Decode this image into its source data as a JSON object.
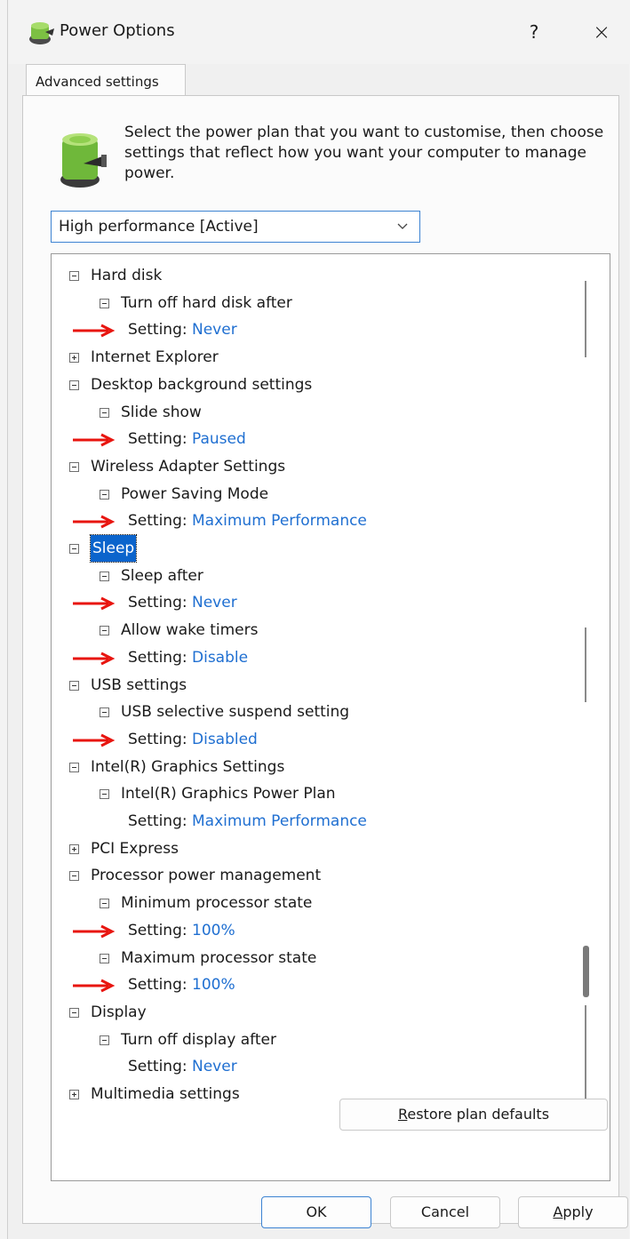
{
  "window": {
    "title": "Power Options",
    "help_label": "?",
    "close_label": "×"
  },
  "tab": {
    "label": "Advanced settings"
  },
  "intro_text": "Select the power plan that you want to customise, then choose settings that reflect how you want your computer to manage power.",
  "plan_select": {
    "value": "High performance [Active]"
  },
  "setting_prefix": "Setting:",
  "tree": [
    {
      "label": "Hard disk",
      "level": 0,
      "toggle": "minus"
    },
    {
      "label": "Turn off hard disk after",
      "level": 1,
      "toggle": "minus"
    },
    {
      "label": "Setting:",
      "value": "Never",
      "level": 2,
      "arrow": true
    },
    {
      "label": "Internet Explorer",
      "level": 0,
      "toggle": "plus"
    },
    {
      "label": "Desktop background settings",
      "level": 0,
      "toggle": "minus"
    },
    {
      "label": "Slide show",
      "level": 1,
      "toggle": "minus"
    },
    {
      "label": "Setting:",
      "value": "Paused",
      "level": 2,
      "arrow": true
    },
    {
      "label": "Wireless Adapter Settings",
      "level": 0,
      "toggle": "minus"
    },
    {
      "label": "Power Saving Mode",
      "level": 1,
      "toggle": "minus"
    },
    {
      "label": "Setting:",
      "value": "Maximum Performance",
      "level": 2,
      "arrow": true
    },
    {
      "label": "Sleep",
      "level": 0,
      "toggle": "minus",
      "selected": true
    },
    {
      "label": "Sleep after",
      "level": 1,
      "toggle": "minus"
    },
    {
      "label": "Setting:",
      "value": "Never",
      "level": 2,
      "arrow": true
    },
    {
      "label": "Allow wake timers",
      "level": 1,
      "toggle": "minus"
    },
    {
      "label": "Setting:",
      "value": "Disable",
      "level": 2,
      "arrow": true
    },
    {
      "label": "USB settings",
      "level": 0,
      "toggle": "minus"
    },
    {
      "label": "USB selective suspend setting",
      "level": 1,
      "toggle": "minus"
    },
    {
      "label": "Setting:",
      "value": "Disabled",
      "level": 2,
      "arrow": true
    },
    {
      "label": "Intel(R) Graphics Settings",
      "level": 0,
      "toggle": "minus"
    },
    {
      "label": "Intel(R) Graphics Power Plan",
      "level": 1,
      "toggle": "minus"
    },
    {
      "label": "Setting:",
      "value": "Maximum Performance",
      "level": 2,
      "arrow": false
    },
    {
      "label": "PCI Express",
      "level": 0,
      "toggle": "plus"
    },
    {
      "label": "Processor power management",
      "level": 0,
      "toggle": "minus"
    },
    {
      "label": "Minimum processor state",
      "level": 1,
      "toggle": "minus"
    },
    {
      "label": "Setting:",
      "value": "100%",
      "level": 2,
      "arrow": true
    },
    {
      "label": "Maximum processor state",
      "level": 1,
      "toggle": "minus"
    },
    {
      "label": "Setting:",
      "value": "100%",
      "level": 2,
      "arrow": true
    },
    {
      "label": "Display",
      "level": 0,
      "toggle": "minus"
    },
    {
      "label": "Turn off display after",
      "level": 1,
      "toggle": "minus"
    },
    {
      "label": "Setting:",
      "value": "Never",
      "level": 2,
      "arrow": false
    },
    {
      "label": "Multimedia settings",
      "level": 0,
      "toggle": "plus"
    }
  ],
  "buttons": {
    "restore_mnemonic": "R",
    "restore_rest": "estore plan defaults",
    "ok": "OK",
    "cancel": "Cancel",
    "apply_mnemonic": "A",
    "apply_rest": "pply"
  },
  "colors": {
    "setting_value": "#1f6fd1",
    "selection": "#0b64cc",
    "annotation_arrow": "#e8150f",
    "focus_border": "#3c83d2"
  }
}
